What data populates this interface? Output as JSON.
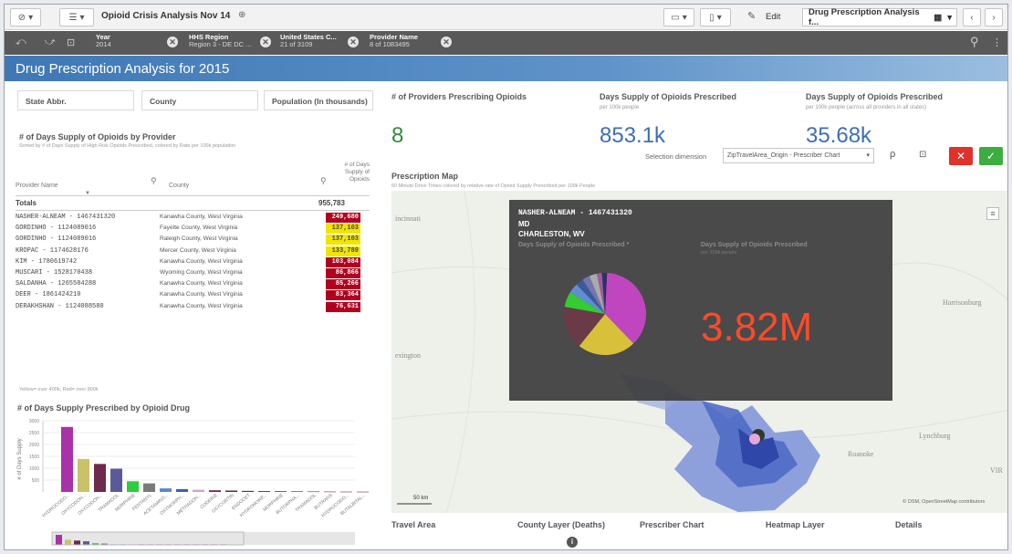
{
  "toolbar": {
    "app_title": "Opioid Crisis Analysis Nov 14",
    "edit_label": "Edit",
    "sheet_name": "Drug Prescription Analysis f..."
  },
  "selections": [
    {
      "caption": "Year",
      "value": "2014"
    },
    {
      "caption": "HHS Region",
      "value": "Region 3 - DE DC ..."
    },
    {
      "caption": "United States C...",
      "value": "21 of 3109"
    },
    {
      "caption": "Provider Name",
      "value": "8 of 1083495"
    }
  ],
  "sheet_title": "Drug Prescription Analysis for 2015",
  "filters": [
    "State Abbr.",
    "County",
    "Population (In thousands)"
  ],
  "kpis": [
    {
      "title": "# of Providers Prescribing Opioids",
      "sub": "",
      "value": "8"
    },
    {
      "title": "Days Supply of Opioids Prescribed",
      "sub": "per 100k people",
      "value": "853.1k"
    },
    {
      "title": "Days Supply of Opioids Prescribed",
      "sub": "per 100k people (across all providers in all states)",
      "value": "35.68k"
    }
  ],
  "table": {
    "title": "# of Days Supply of Opioids by Provider",
    "subtitle": "Sorted by # of Days Supply of High Risk Opioids Prescribed, colored by Rate per 100k population",
    "headers": {
      "provider": "Provider Name",
      "county": "County",
      "value": "# of Days Supply of Opioids"
    },
    "totals_label": "Totals",
    "totals_value": "955,783",
    "rows": [
      {
        "provider": "NASHER-ALNEAM - 1467431320",
        "county": "Kanawha County, West Virginia",
        "value": "249,680",
        "color": "#b0001e",
        "text": "#ffffff"
      },
      {
        "provider": "GORDINHO - 1124089016",
        "county": "Fayette County, West Virginia",
        "value": "137,103",
        "color": "#f1e500",
        "text": "#444444"
      },
      {
        "provider": "GORDINHO - 1124089016",
        "county": "Raleigh County, West Virginia",
        "value": "137,103",
        "color": "#f1e500",
        "text": "#444444"
      },
      {
        "provider": "KROPAC - 1174628176",
        "county": "Mercer County, West Virginia",
        "value": "133,789",
        "color": "#f1e500",
        "text": "#444444"
      },
      {
        "provider": "KIM - 1780619742",
        "county": "Kanawha County, West Virginia",
        "value": "103,084",
        "color": "#b0001e",
        "text": "#ffffff"
      },
      {
        "provider": "MUSCARI - 1528170438",
        "county": "Wyoming County, West Virginia",
        "value": "86,866",
        "color": "#b0001e",
        "text": "#ffffff"
      },
      {
        "provider": "SALDANHA - 1265584288",
        "county": "Kanawha County, West Virginia",
        "value": "85,266",
        "color": "#b0001e",
        "text": "#ffffff"
      },
      {
        "provider": "DEER - 1861424210",
        "county": "Kanawha County, West Virginia",
        "value": "83,364",
        "color": "#b0001e",
        "text": "#ffffff"
      },
      {
        "provider": "DERAKHSHAN - 1124088580",
        "county": "Kanawha County, West Virginia",
        "value": "76,631",
        "color": "#b0001e",
        "text": "#ffffff"
      }
    ],
    "footnote": "Yellow= over 400k, Red= over 800k"
  },
  "chart_data": {
    "type": "bar",
    "title": "# of Days Supply Prescribed by Opioid Drug",
    "ylabel": "# of Days Supply",
    "yticks": [
      "3000",
      "2500",
      "2000",
      "1500",
      "1000",
      "500"
    ],
    "ylim": [
      0,
      3000
    ],
    "categories": [
      "HYDROCODO...",
      "OXYCODON...",
      "OXYCODON...",
      "TRAMADOL",
      "MORPHINE",
      "FENTANYL",
      "ACETAMINO...",
      "OXYMORPH...",
      "METHADON...",
      "CODEINE",
      "OXYCONTIN",
      "ENDOCET",
      "HYDROMORP...",
      "MORPHINE",
      "BUTORPHA...",
      "TRAMADOL",
      "BUTRANS",
      "HYDROCODO...",
      "BUTALBITAL..."
    ],
    "values": [
      2740,
      1390,
      1180,
      980,
      450,
      360,
      150,
      120,
      90,
      70,
      60,
      45,
      35,
      30,
      25,
      20,
      15,
      12,
      10
    ],
    "colors": [
      "#a832a8",
      "#c9c26a",
      "#6e2a4a",
      "#5a5a9a",
      "#2ecc40",
      "#7a7a7a",
      "#5d88c5",
      "#3d5fa8",
      "#d2a1c8",
      "#6e2a4a",
      "#6e2a4a",
      "#6e2a4a",
      "#6e2a4a",
      "#6e2a4a",
      "#6e2a4a",
      "#6e2a4a",
      "#6e2a4a",
      "#6e2a4a",
      "#6e2a4a"
    ]
  },
  "map_panel": {
    "selection_dimension_label": "Selection dimension",
    "selection_dimension_value": "ZipTravelArea_Origin - Prescriber Chart",
    "title": "Prescription Map",
    "subtitle": "60 Minute Drive Times colored by relative rate of Opioid Supply Prescribed per 100k People",
    "place_labels": [
      "incinnati",
      "exington",
      "Harrisonburg",
      "Lynchburg",
      "Roanoke",
      "VIR"
    ],
    "scale_label": "50 km",
    "attribution": "© OSM, OpenStreetMap contributors",
    "tooltip": {
      "name": "NASHER-ALNEAM - 1467431320",
      "degree": "MD",
      "city": "CHARLESTON, WV",
      "col1": "Days Supply of Opioids Prescribed *",
      "col2": "Days Supply of Opioids Prescribed",
      "col2_sub": "per 100k people",
      "big_value": "3.82M"
    },
    "pie_slices": [
      {
        "value": 37,
        "color": "#c046c0"
      },
      {
        "value": 23,
        "color": "#d8c03a"
      },
      {
        "value": 17,
        "color": "#6a3a46"
      },
      {
        "value": 6,
        "color": "#33cc33"
      },
      {
        "value": 4,
        "color": "#5f8fd2"
      },
      {
        "value": 3,
        "color": "#3a5a9a"
      },
      {
        "value": 3,
        "color": "#7575b0"
      },
      {
        "value": 3,
        "color": "#aaaaaa"
      },
      {
        "value": 2,
        "color": "#9b5e9b"
      },
      {
        "value": 2,
        "color": "#2f2f6a"
      }
    ],
    "tabs": [
      "Travel Area",
      "County Layer (Deaths)",
      "Prescriber Chart",
      "Heatmap Layer",
      "Details"
    ]
  }
}
